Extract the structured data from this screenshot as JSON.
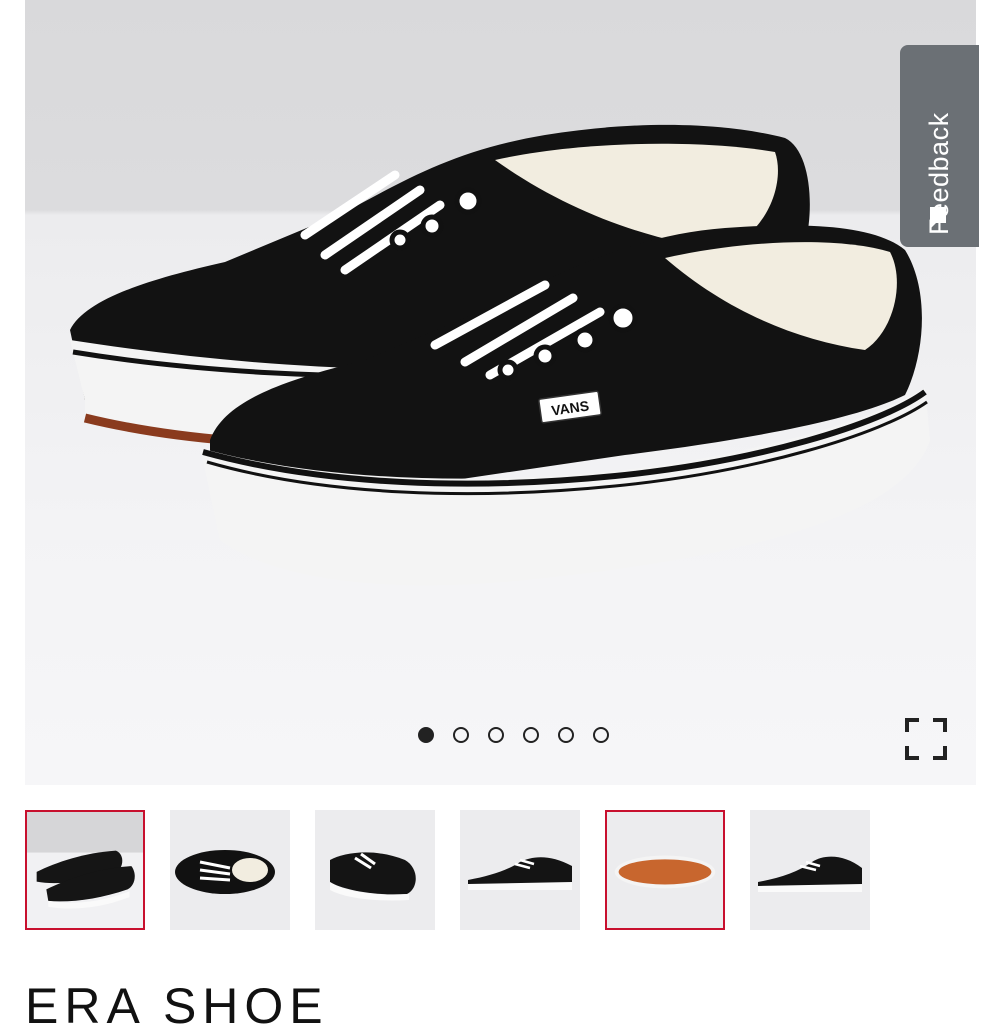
{
  "feedback": {
    "label": "Feedback",
    "icon": "chat-bubble-icon"
  },
  "hero": {
    "product_image": "black-canvas-shoe-pair",
    "brand_tag": "VANS",
    "active_slide": 1,
    "slide_count": 6
  },
  "expand": {
    "icon": "fullscreen-icon"
  },
  "thumbnails": [
    {
      "view": "pair-angle",
      "selected": true
    },
    {
      "view": "top-down",
      "selected": false
    },
    {
      "view": "toe-angle",
      "selected": false
    },
    {
      "view": "side-profile",
      "selected": false
    },
    {
      "view": "outsole",
      "selected": true
    },
    {
      "view": "side-profile-alt",
      "selected": false
    }
  ],
  "product": {
    "title": "ERA SHOE"
  },
  "colors": {
    "selected_border": "#c8102e",
    "feedback_bg": "#6b7075",
    "dot": "#222222"
  }
}
